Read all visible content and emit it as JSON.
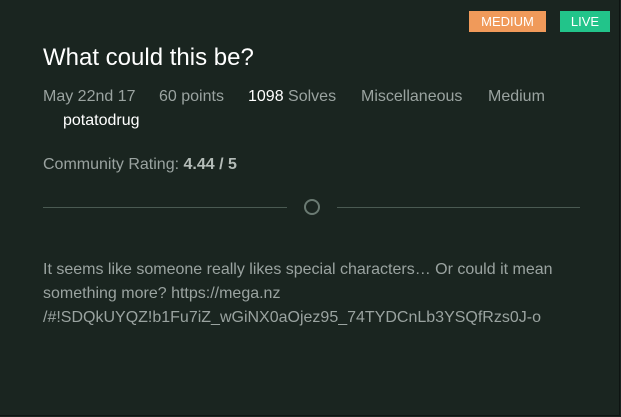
{
  "badges": {
    "difficulty": "MEDIUM",
    "status": "LIVE"
  },
  "challenge": {
    "title": "What could this be?",
    "date": "May 22nd 17",
    "points": "60 points",
    "solves_count": "1098",
    "solves_label": "Solves",
    "category": "Miscellaneous",
    "difficulty": "Medium",
    "author": "potatodrug"
  },
  "rating": {
    "label": "Community Rating:",
    "value": "4.44 / 5"
  },
  "description": {
    "lines": [
      "It seems like someone really likes special characters… Or could it mean",
      "something more? https://mega.nz",
      "/#!SDQkUYQZ!b1Fu7iZ_wGiNX0aOjez95_74TYDCnLb3YSQfRzs0J-o"
    ]
  },
  "colors": {
    "background": "#1a2520",
    "medium_badge": "#f09a5a",
    "live_badge": "#22c48a",
    "title": "#ffffff",
    "muted_text": "#9aa3a0"
  }
}
